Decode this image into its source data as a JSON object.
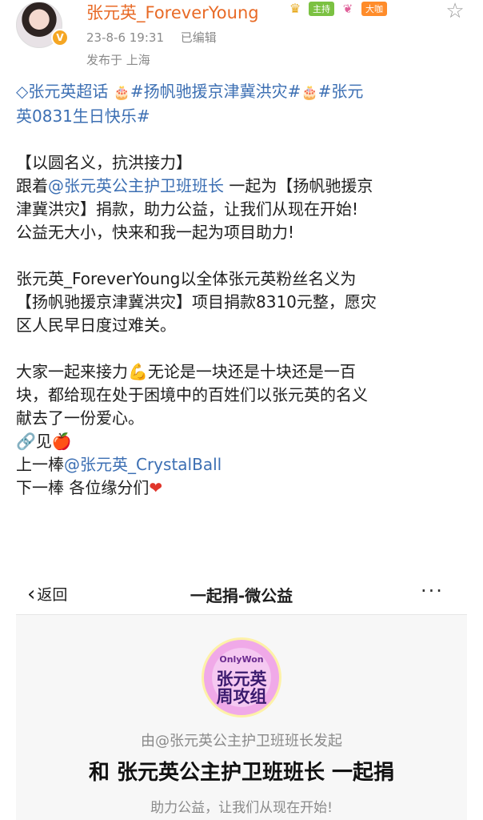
{
  "header": {
    "username": "张元英_ForeverYoung",
    "badge_host": "主持",
    "badge_big": "大咖",
    "verify_mark": "V",
    "time": "23-8-6 19:31",
    "edited": "已编辑",
    "location": "发布于 上海"
  },
  "post": {
    "topic_1": "张元英超话",
    "topic_2": "#扬帆驰援京津冀洪灾#",
    "topic_3a": "#张元",
    "topic_3b": "英0831生日快乐#",
    "title_line": "【以圆名义，抗洪接力】",
    "line_follow_prefix": "跟着",
    "mention_1": "@张元英公主护卫班班长",
    "line_follow_suffix": " 一起为【扬帆驰援京",
    "line_2": "津冀洪灾】捐款，助力公益，让我们从现在开始!",
    "line_3": "公益无大小，快来和我一起为项目助力!",
    "para2_line1": "张元英_ForeverYoung以全体张元英粉丝名义为",
    "para2_line2": "【扬帆驰援京津冀洪灾】项目捐款8310元整，愿灾",
    "para2_line3": "区人民早日度过难关。",
    "para3_line1a": "大家一起来接力",
    "para3_line1b": "无论是一块还是十块还是一百",
    "para3_line2": "块，都给现在处于困境中的百姓们以张元英的名义",
    "para3_line3": "献去了一份爱心。",
    "link_line": "见",
    "prev_prefix": "上一棒",
    "mention_2": "@张元英_CrystalBall",
    "next_line": "下一棒 各位缘分们"
  },
  "embedded": {
    "back_label": "返回",
    "page_title": "一起捐-微公益",
    "logo_top": "OnlyWon",
    "logo_main": "张元英\n周攻组",
    "initiator": "由@张元英公主护卫班班长发起",
    "donate_title": "和 张元英公主护卫班班长 一起捐",
    "slogan": "助力公益，让我们从现在开始!"
  },
  "colors": {
    "username": "#e86a26",
    "link": "#3c6fb3",
    "meta": "#8a8a8a"
  },
  "icons": [
    "crown-icon",
    "brain-icon",
    "star-icon",
    "diamond-icon",
    "cake-icon",
    "flex-arm-icon",
    "link-icon",
    "apple-icon",
    "heart-icon",
    "back-chevron-icon",
    "more-icon"
  ]
}
